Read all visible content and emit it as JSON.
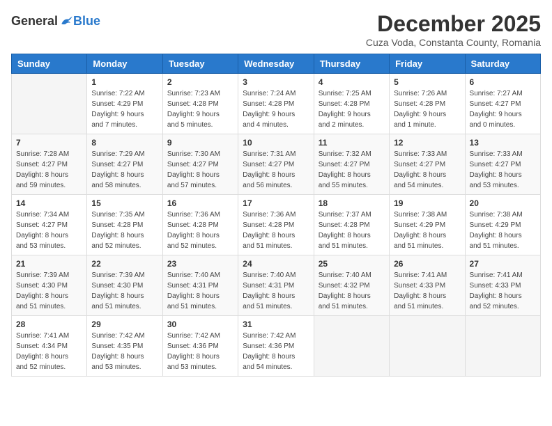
{
  "logo": {
    "general": "General",
    "blue": "Blue"
  },
  "title": "December 2025",
  "subtitle": "Cuza Voda, Constanta County, Romania",
  "header_days": [
    "Sunday",
    "Monday",
    "Tuesday",
    "Wednesday",
    "Thursday",
    "Friday",
    "Saturday"
  ],
  "weeks": [
    [
      {
        "day": "",
        "info": ""
      },
      {
        "day": "1",
        "info": "Sunrise: 7:22 AM\nSunset: 4:29 PM\nDaylight: 9 hours\nand 7 minutes."
      },
      {
        "day": "2",
        "info": "Sunrise: 7:23 AM\nSunset: 4:28 PM\nDaylight: 9 hours\nand 5 minutes."
      },
      {
        "day": "3",
        "info": "Sunrise: 7:24 AM\nSunset: 4:28 PM\nDaylight: 9 hours\nand 4 minutes."
      },
      {
        "day": "4",
        "info": "Sunrise: 7:25 AM\nSunset: 4:28 PM\nDaylight: 9 hours\nand 2 minutes."
      },
      {
        "day": "5",
        "info": "Sunrise: 7:26 AM\nSunset: 4:28 PM\nDaylight: 9 hours\nand 1 minute."
      },
      {
        "day": "6",
        "info": "Sunrise: 7:27 AM\nSunset: 4:27 PM\nDaylight: 9 hours\nand 0 minutes."
      }
    ],
    [
      {
        "day": "7",
        "info": "Sunrise: 7:28 AM\nSunset: 4:27 PM\nDaylight: 8 hours\nand 59 minutes."
      },
      {
        "day": "8",
        "info": "Sunrise: 7:29 AM\nSunset: 4:27 PM\nDaylight: 8 hours\nand 58 minutes."
      },
      {
        "day": "9",
        "info": "Sunrise: 7:30 AM\nSunset: 4:27 PM\nDaylight: 8 hours\nand 57 minutes."
      },
      {
        "day": "10",
        "info": "Sunrise: 7:31 AM\nSunset: 4:27 PM\nDaylight: 8 hours\nand 56 minutes."
      },
      {
        "day": "11",
        "info": "Sunrise: 7:32 AM\nSunset: 4:27 PM\nDaylight: 8 hours\nand 55 minutes."
      },
      {
        "day": "12",
        "info": "Sunrise: 7:33 AM\nSunset: 4:27 PM\nDaylight: 8 hours\nand 54 minutes."
      },
      {
        "day": "13",
        "info": "Sunrise: 7:33 AM\nSunset: 4:27 PM\nDaylight: 8 hours\nand 53 minutes."
      }
    ],
    [
      {
        "day": "14",
        "info": "Sunrise: 7:34 AM\nSunset: 4:27 PM\nDaylight: 8 hours\nand 53 minutes."
      },
      {
        "day": "15",
        "info": "Sunrise: 7:35 AM\nSunset: 4:28 PM\nDaylight: 8 hours\nand 52 minutes."
      },
      {
        "day": "16",
        "info": "Sunrise: 7:36 AM\nSunset: 4:28 PM\nDaylight: 8 hours\nand 52 minutes."
      },
      {
        "day": "17",
        "info": "Sunrise: 7:36 AM\nSunset: 4:28 PM\nDaylight: 8 hours\nand 51 minutes."
      },
      {
        "day": "18",
        "info": "Sunrise: 7:37 AM\nSunset: 4:28 PM\nDaylight: 8 hours\nand 51 minutes."
      },
      {
        "day": "19",
        "info": "Sunrise: 7:38 AM\nSunset: 4:29 PM\nDaylight: 8 hours\nand 51 minutes."
      },
      {
        "day": "20",
        "info": "Sunrise: 7:38 AM\nSunset: 4:29 PM\nDaylight: 8 hours\nand 51 minutes."
      }
    ],
    [
      {
        "day": "21",
        "info": "Sunrise: 7:39 AM\nSunset: 4:30 PM\nDaylight: 8 hours\nand 51 minutes."
      },
      {
        "day": "22",
        "info": "Sunrise: 7:39 AM\nSunset: 4:30 PM\nDaylight: 8 hours\nand 51 minutes."
      },
      {
        "day": "23",
        "info": "Sunrise: 7:40 AM\nSunset: 4:31 PM\nDaylight: 8 hours\nand 51 minutes."
      },
      {
        "day": "24",
        "info": "Sunrise: 7:40 AM\nSunset: 4:31 PM\nDaylight: 8 hours\nand 51 minutes."
      },
      {
        "day": "25",
        "info": "Sunrise: 7:40 AM\nSunset: 4:32 PM\nDaylight: 8 hours\nand 51 minutes."
      },
      {
        "day": "26",
        "info": "Sunrise: 7:41 AM\nSunset: 4:33 PM\nDaylight: 8 hours\nand 51 minutes."
      },
      {
        "day": "27",
        "info": "Sunrise: 7:41 AM\nSunset: 4:33 PM\nDaylight: 8 hours\nand 52 minutes."
      }
    ],
    [
      {
        "day": "28",
        "info": "Sunrise: 7:41 AM\nSunset: 4:34 PM\nDaylight: 8 hours\nand 52 minutes."
      },
      {
        "day": "29",
        "info": "Sunrise: 7:42 AM\nSunset: 4:35 PM\nDaylight: 8 hours\nand 53 minutes."
      },
      {
        "day": "30",
        "info": "Sunrise: 7:42 AM\nSunset: 4:36 PM\nDaylight: 8 hours\nand 53 minutes."
      },
      {
        "day": "31",
        "info": "Sunrise: 7:42 AM\nSunset: 4:36 PM\nDaylight: 8 hours\nand 54 minutes."
      },
      {
        "day": "",
        "info": ""
      },
      {
        "day": "",
        "info": ""
      },
      {
        "day": "",
        "info": ""
      }
    ]
  ]
}
